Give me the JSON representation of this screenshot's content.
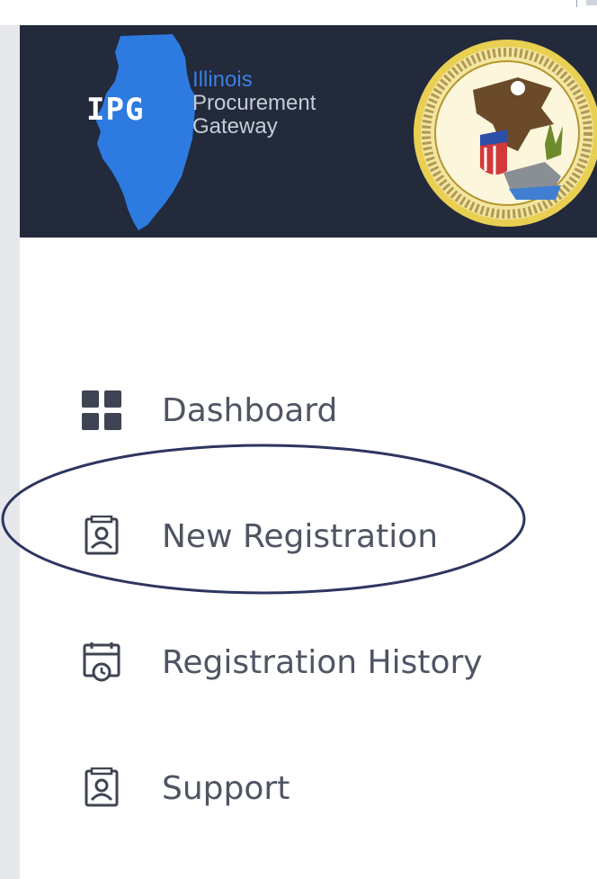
{
  "banner": {
    "brand_mark": "IPG",
    "brand_line1": "Illinois",
    "brand_line2": "Procurement",
    "brand_line3": "Gateway",
    "background_color": "#222a3b",
    "seal_icon": "state-seal-icon"
  },
  "nav": {
    "items": [
      {
        "label": "Dashboard",
        "icon": "dashboard-grid-icon"
      },
      {
        "label": "New Registration",
        "icon": "registration-badge-icon",
        "highlighted": true
      },
      {
        "label": "Registration History",
        "icon": "history-calendar-icon"
      },
      {
        "label": "Support",
        "icon": "support-badge-icon"
      }
    ]
  },
  "colors": {
    "label": "#4f5563",
    "icon": "#3f4452",
    "annotation": "#2d3560",
    "brand_blue": "#2d7be0"
  }
}
